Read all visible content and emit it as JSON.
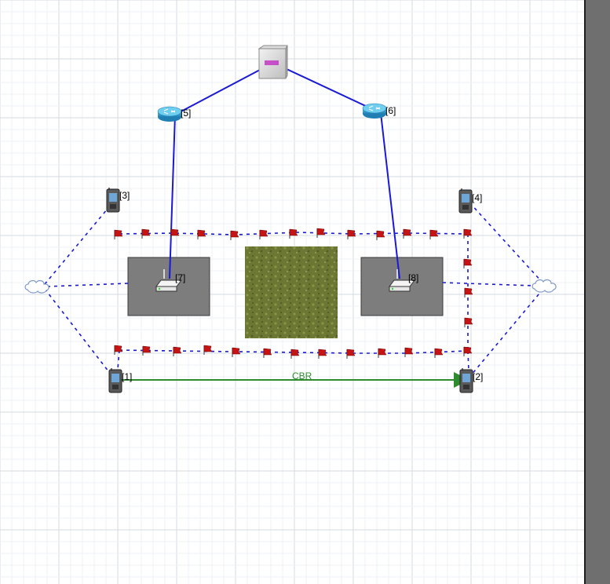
{
  "canvas": {
    "background": "#ffffff",
    "grid_minor": "#eef1f4",
    "grid_major": "#d6dbe0"
  },
  "links": {
    "wired_color": "#1a1ad6",
    "wireless_color": "#1a1ad6",
    "flow_color": "#2e8b2e"
  },
  "nodes": {
    "n1": {
      "label": "[1]",
      "icon": "pda-icon"
    },
    "n2": {
      "label": "[2]",
      "icon": "pda-icon"
    },
    "n3": {
      "label": "[3]",
      "icon": "pda-icon"
    },
    "n4": {
      "label": "[4]",
      "icon": "pda-icon"
    },
    "n5": {
      "label": "[5]",
      "icon": "router-icon"
    },
    "n6": {
      "label": "[6]",
      "icon": "router-icon"
    },
    "n7": {
      "label": "[7]",
      "icon": "access-point-icon"
    },
    "n8": {
      "label": "[8]",
      "icon": "access-point-icon"
    },
    "hub": {
      "icon": "hub-box-icon"
    },
    "cloud_left": {
      "icon": "cloud-icon"
    },
    "cloud_right": {
      "icon": "cloud-icon"
    }
  },
  "flow": {
    "label": "CBR"
  },
  "obstacles": {
    "building_color": "#7d7d7d",
    "grass_color": "#6e7a36"
  },
  "waypoint_flag": {
    "icon": "flag-icon",
    "color": "#c41414"
  }
}
